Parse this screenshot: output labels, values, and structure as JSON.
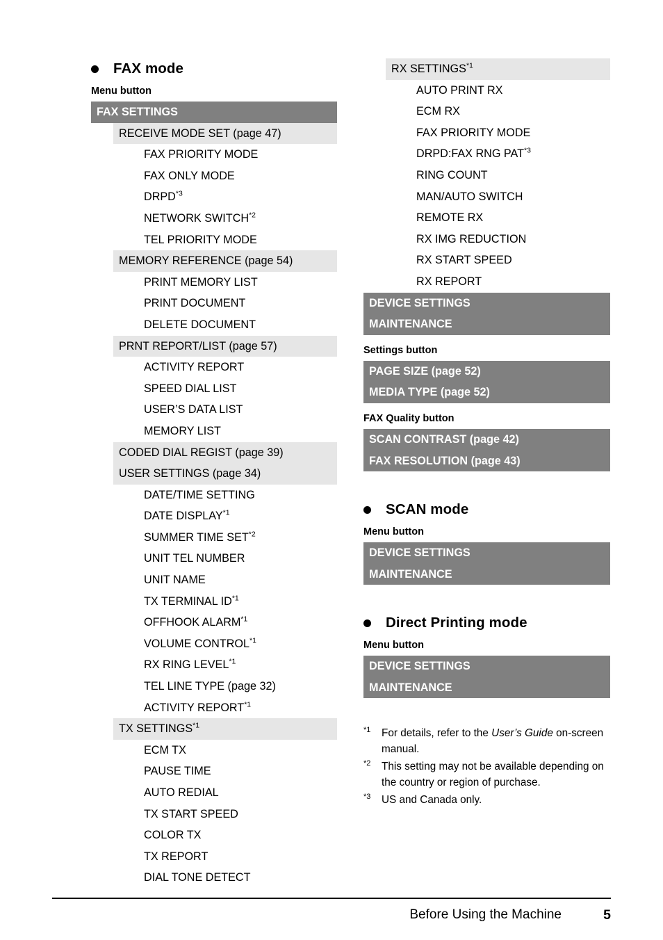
{
  "page": {
    "footer_title": "Before Using the Machine",
    "footer_page_number": "5",
    "colors": {
      "dark_band": "#808080",
      "light_band": "#e6e6e6",
      "text": "#000000",
      "band_text_light": "#ffffff"
    }
  },
  "sections": {
    "fax_mode": {
      "heading": "FAX mode",
      "sub_heading": "Menu button",
      "items": {
        "fax_settings": "FAX SETTINGS",
        "receive_mode_set": "RECEIVE MODE SET (page 47)",
        "fax_priority_mode": "FAX PRIORITY MODE",
        "fax_only_mode": "FAX ONLY MODE",
        "drpd": "DRPD",
        "drpd_note": "*3",
        "network_switch": "NETWORK SWITCH",
        "network_switch_note": "*2",
        "tel_priority_mode": "TEL PRIORITY MODE",
        "memory_reference": "MEMORY REFERENCE (page 54)",
        "print_memory_list": "PRINT MEMORY LIST",
        "print_document": "PRINT DOCUMENT",
        "delete_document": "DELETE DOCUMENT",
        "prnt_report_list": "PRNT REPORT/LIST (page 57)",
        "activity_report": "ACTIVITY REPORT",
        "speed_dial_list": "SPEED DIAL LIST",
        "users_data_list": "USER’S DATA LIST",
        "memory_list": "MEMORY LIST",
        "coded_dial_regist": "CODED DIAL REGIST (page 39)",
        "user_settings": "USER SETTINGS (page 34)",
        "date_time_setting": "DATE/TIME SETTING",
        "date_display": "DATE DISPLAY",
        "date_display_note": "*1",
        "summer_time_set": "SUMMER TIME SET",
        "summer_time_set_note": "*2",
        "unit_tel_number": "UNIT TEL NUMBER",
        "unit_name": "UNIT NAME",
        "tx_terminal_id": "TX TERMINAL ID",
        "tx_terminal_id_note": "*1",
        "offhook_alarm": "OFFHOOK ALARM",
        "offhook_alarm_note": "*1",
        "volume_control": "VOLUME CONTROL",
        "volume_control_note": "*1",
        "rx_ring_level": "RX RING LEVEL",
        "rx_ring_level_note": "*1",
        "tel_line_type": "TEL LINE TYPE (page 32)",
        "activity_report_2": "ACTIVITY REPORT",
        "activity_report_2_note": "*1",
        "tx_settings": "TX SETTINGS",
        "tx_settings_note": "*1",
        "ecm_tx": "ECM TX",
        "pause_time": "PAUSE TIME",
        "auto_redial": "AUTO REDIAL",
        "tx_start_speed": "TX START SPEED",
        "color_tx": "COLOR TX",
        "tx_report": "TX REPORT",
        "dial_tone_detect": "DIAL TONE DETECT",
        "rx_settings": "RX SETTINGS",
        "rx_settings_note": "*1",
        "auto_print_rx": "AUTO PRINT RX",
        "ecm_rx": "ECM RX",
        "fax_priority_mode_rx": "FAX PRIORITY MODE",
        "drpd_fax_rng_pat": "DRPD:FAX RNG PAT",
        "drpd_fax_rng_pat_note": "*3",
        "ring_count": "RING COUNT",
        "man_auto_switch": "MAN/AUTO SWITCH",
        "remote_rx": "REMOTE RX",
        "rx_img_reduction": "RX IMG REDUCTION",
        "rx_start_speed": "RX START SPEED",
        "rx_report": "RX REPORT",
        "device_settings": "DEVICE SETTINGS",
        "maintenance": "MAINTENANCE"
      },
      "settings_button": {
        "sub_heading": "Settings button",
        "page_size": "PAGE SIZE (page 52)",
        "media_type": "MEDIA TYPE (page 52)"
      },
      "fax_quality_button": {
        "sub_heading": "FAX Quality button",
        "scan_contrast": "SCAN CONTRAST (page 42)",
        "fax_resolution": "FAX RESOLUTION (page 43)"
      }
    },
    "scan_mode": {
      "heading": "SCAN mode",
      "sub_heading": "Menu button",
      "device_settings": "DEVICE SETTINGS",
      "maintenance": "MAINTENANCE"
    },
    "direct_printing_mode": {
      "heading": "Direct Printing mode",
      "sub_heading": "Menu button",
      "device_settings": "DEVICE SETTINGS",
      "maintenance": "MAINTENANCE"
    }
  },
  "footnotes": [
    {
      "mark": "*1",
      "text_before": "For details, refer to the ",
      "italic": "User’s Guide",
      "text_after": " on-screen manual."
    },
    {
      "mark": "*2",
      "text_before": "This setting may not be available depending on the country or region of purchase.",
      "italic": "",
      "text_after": ""
    },
    {
      "mark": "*3",
      "text_before": "US and Canada only.",
      "italic": "",
      "text_after": ""
    }
  ]
}
